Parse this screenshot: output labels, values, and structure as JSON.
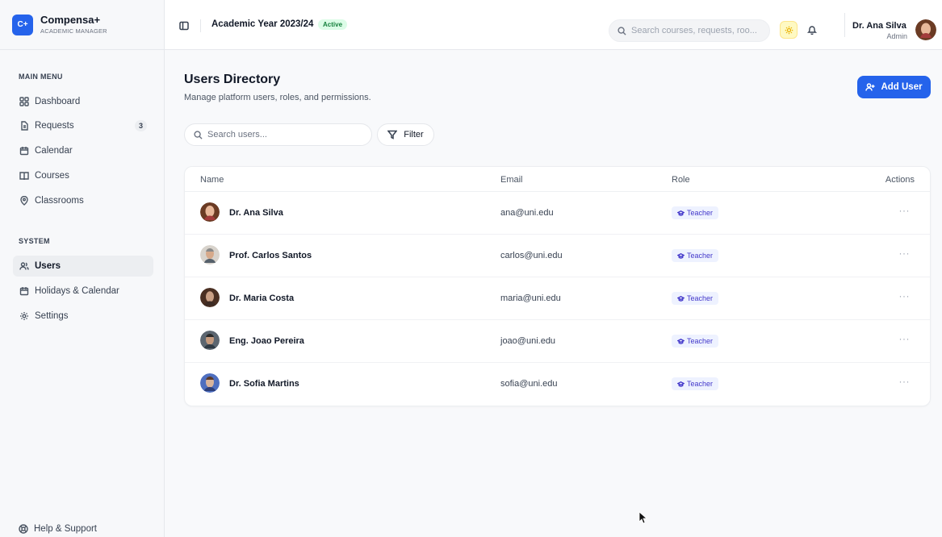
{
  "brand": {
    "logo": "C+",
    "name": "Compensa+",
    "subtitle": "ACADEMIC MANAGER"
  },
  "sidebar": {
    "main_menu_label": "MAIN MENU",
    "main_items": [
      {
        "label": "Dashboard",
        "icon": "grid-icon"
      },
      {
        "label": "Requests",
        "icon": "document-icon",
        "badge": "3"
      },
      {
        "label": "Calendar",
        "icon": "calendar-icon"
      },
      {
        "label": "Courses",
        "icon": "book-icon"
      },
      {
        "label": "Classrooms",
        "icon": "map-pin-icon"
      }
    ],
    "system_label": "SYSTEM",
    "system_items": [
      {
        "label": "Users",
        "icon": "users-icon",
        "active": true
      },
      {
        "label": "Holidays & Calendar",
        "icon": "calendar-icon"
      },
      {
        "label": "Settings",
        "icon": "gear-icon"
      }
    ],
    "help_label": "Help & Support"
  },
  "topbar": {
    "year_title": "Academic Year 2023/24",
    "status_badge": "Active",
    "search_placeholder": "Search courses, requests, roo...",
    "user_name": "Dr. Ana Silva",
    "user_role": "Admin"
  },
  "main": {
    "title": "Users Directory",
    "subtitle": "Manage platform users, roles, and permissions.",
    "add_user_label": "Add User",
    "search_placeholder": "Search users...",
    "filter_label": "Filter",
    "columns": {
      "name": "Name",
      "email": "Email",
      "role": "Role",
      "actions": "Actions"
    },
    "users": [
      {
        "name": "Dr. Ana Silva",
        "email": "ana@uni.edu",
        "role": "Teacher",
        "actions": "···"
      },
      {
        "name": "Prof. Carlos Santos",
        "email": "carlos@uni.edu",
        "role": "Teacher",
        "actions": "···"
      },
      {
        "name": "Dr. Maria Costa",
        "email": "maria@uni.edu",
        "role": "Teacher",
        "actions": "···"
      },
      {
        "name": "Eng. Joao Pereira",
        "email": "joao@uni.edu",
        "role": "Teacher",
        "actions": "···"
      },
      {
        "name": "Dr. Sofia Martins",
        "email": "sofia@uni.edu",
        "role": "Teacher",
        "actions": "···"
      }
    ]
  },
  "colors": {
    "accent": "#2563eb",
    "active_badge_bg": "#dcfce7",
    "active_badge_text": "#15803d",
    "role_badge_bg": "#eef2ff",
    "role_badge_text": "#4338ca"
  }
}
